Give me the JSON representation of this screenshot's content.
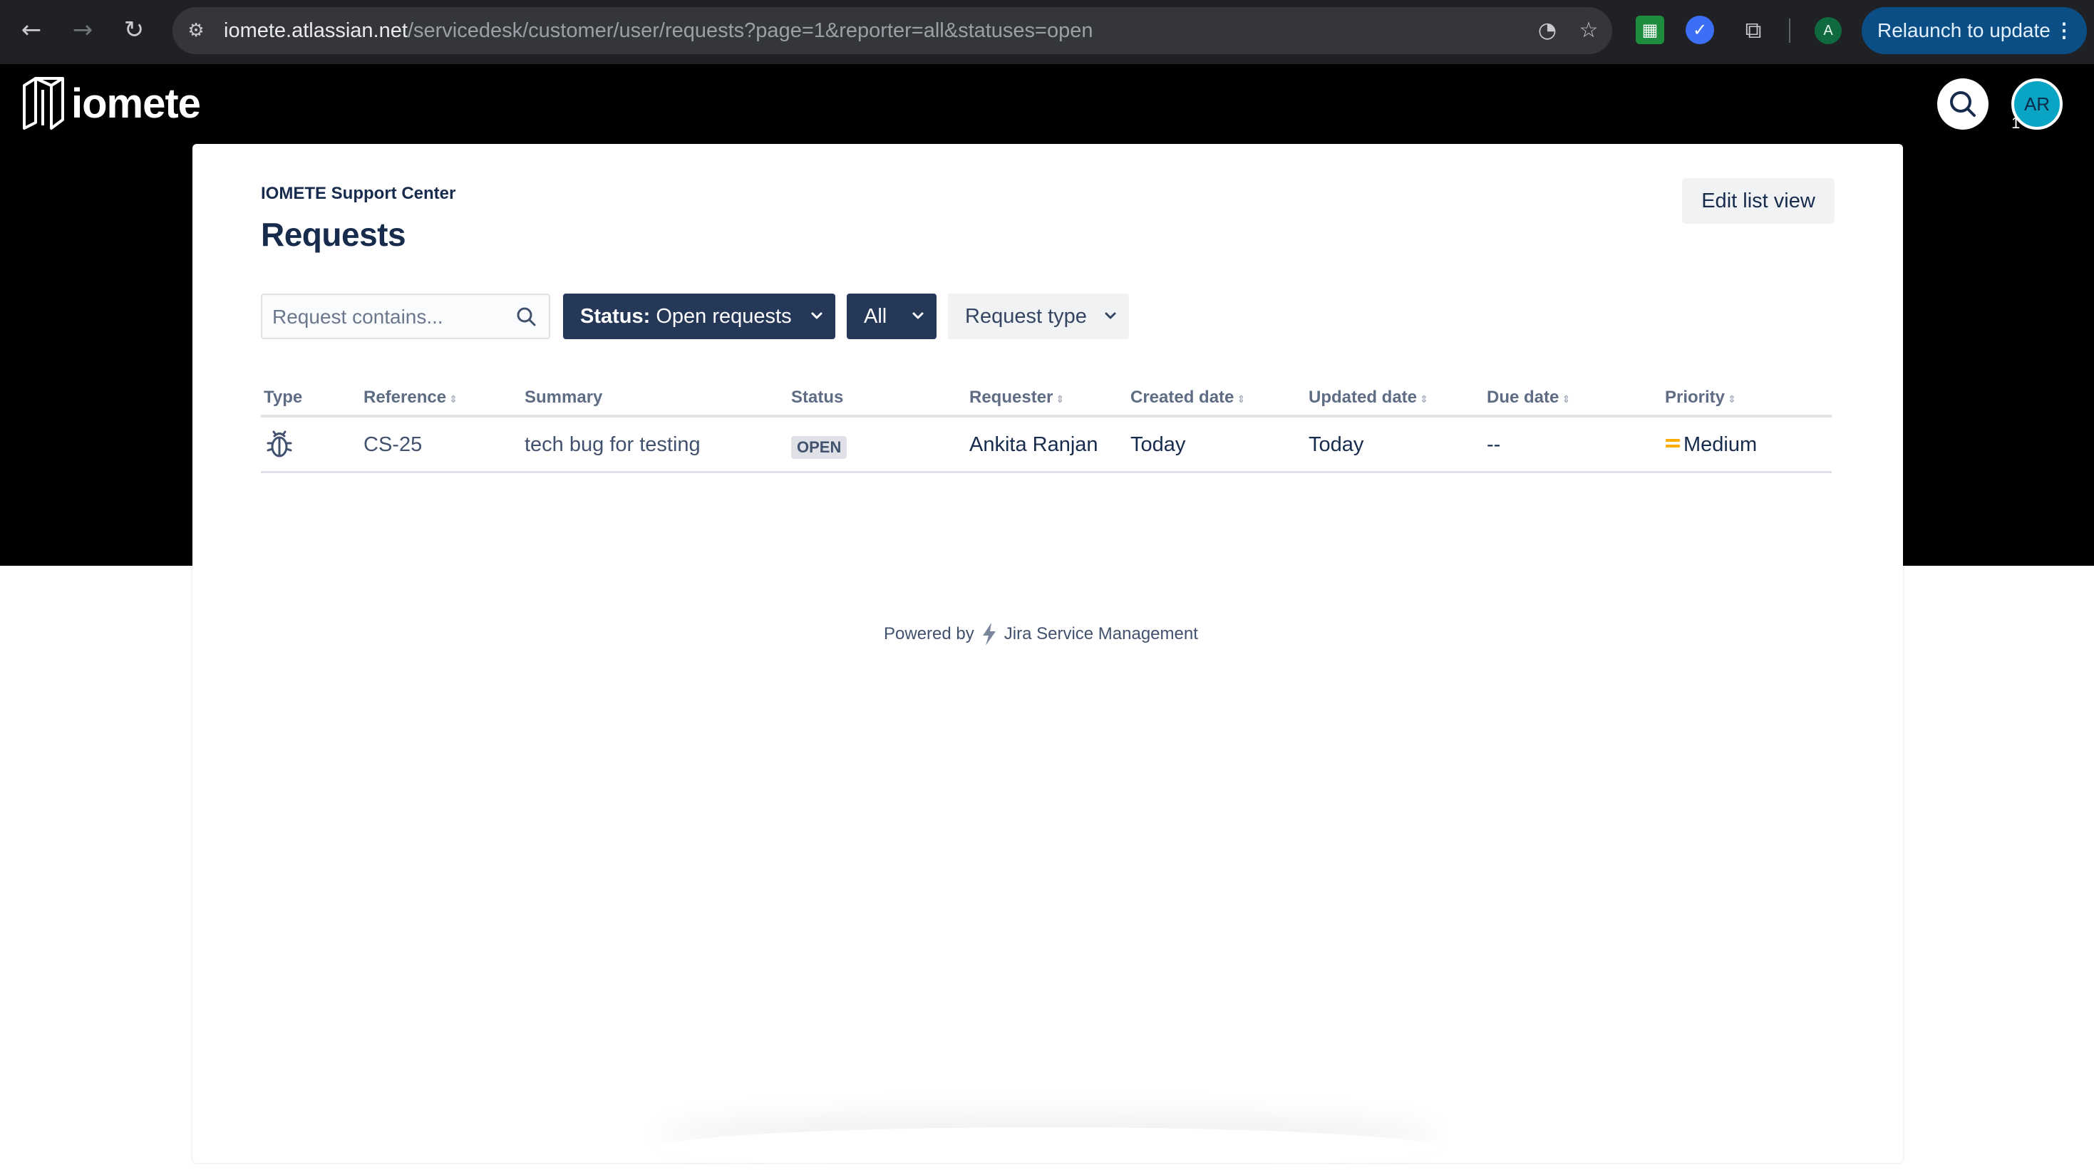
{
  "browser": {
    "url_host": "iomete.atlassian.net",
    "url_path": "/servicedesk/customer/user/requests?page=1&reporter=all&statuses=open",
    "profile_initial": "A",
    "relaunch_label": "Relaunch to update",
    "relaunch_menu": "⋮"
  },
  "header": {
    "logo_text": "iomete",
    "avatar_initials": "AR",
    "avatar_badge": "1"
  },
  "page": {
    "breadcrumb": "IOMETE Support Center",
    "title": "Requests",
    "edit_list_view": "Edit list view"
  },
  "filters": {
    "search_placeholder": "Request contains...",
    "status_prefix": "Status:",
    "status_value": "Open requests",
    "reporter_value": "All",
    "request_type": "Request type"
  },
  "table": {
    "headers": {
      "type": "Type",
      "reference": "Reference",
      "summary": "Summary",
      "status": "Status",
      "requester": "Requester",
      "created": "Created date",
      "updated": "Updated date",
      "due": "Due date",
      "priority": "Priority"
    },
    "rows": [
      {
        "type_icon": "bug-icon",
        "reference": "CS-25",
        "summary": "tech bug for testing",
        "status": "OPEN",
        "requester": "Ankita Ranjan",
        "created": "Today",
        "updated": "Today",
        "due": "--",
        "priority": "Medium"
      }
    ]
  },
  "footer": {
    "powered_by": "Powered by",
    "product": "Jira Service Management"
  },
  "colors": {
    "header_bg": "#000000",
    "primary_button": "#253858",
    "priority_medium": "#ffab00",
    "text": "#172b4d"
  }
}
